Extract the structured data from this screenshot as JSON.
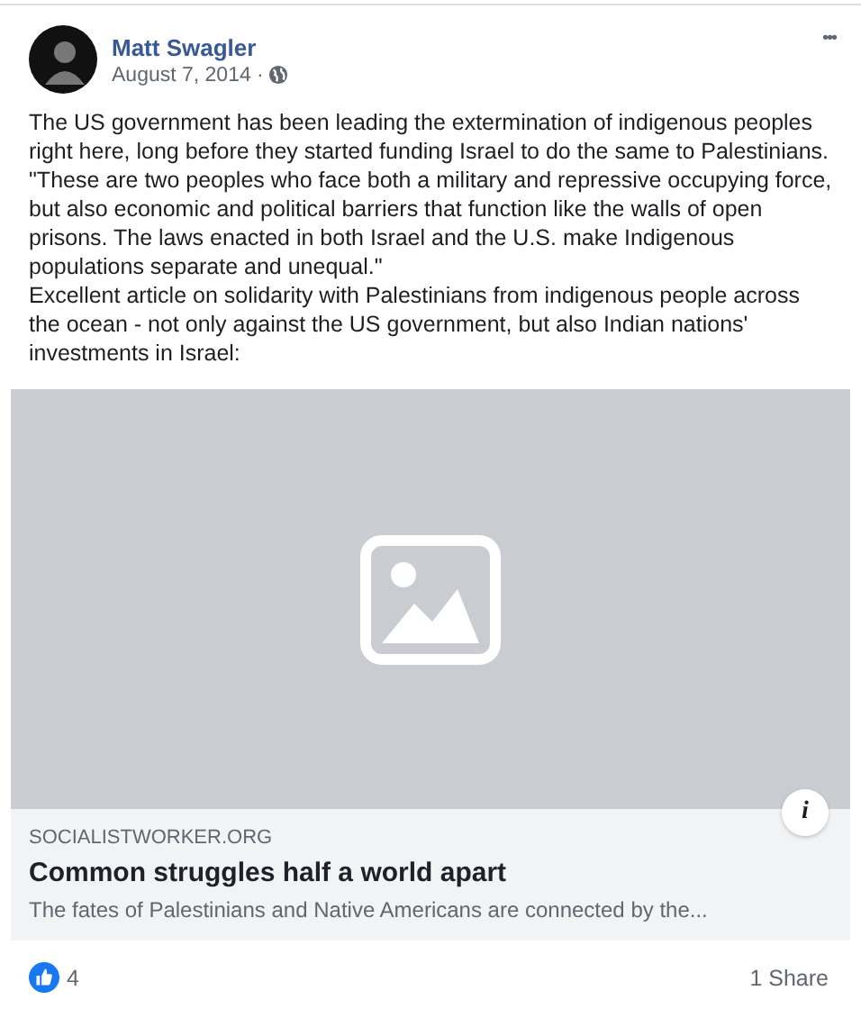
{
  "author": {
    "name": "Matt Swagler",
    "date": "August 7, 2014 ·"
  },
  "more_button": "•••",
  "post_text": [
    "The US government has been leading the extermination of indigenous peoples right here, long before they started funding Israel to do the same to Palestinians. \"These are two peoples who face both a military and repressive occupying force, but also economic and political barriers that function like the walls of open prisons. The laws enacted in both Israel and the U.S. make Indigenous populations separate and unequal.\"",
    "Excellent article on solidarity with Palestinians from indigenous people across the ocean - not only against the US government, but also Indian nations' investments in Israel:"
  ],
  "link_preview": {
    "info_button": "i",
    "domain": "SOCIALISTWORKER.ORG",
    "title": "Common struggles half a world apart",
    "description": "The fates of Palestinians and Native Americans are connected by the..."
  },
  "footer": {
    "reaction_count": "4",
    "shares": "1 Share"
  }
}
